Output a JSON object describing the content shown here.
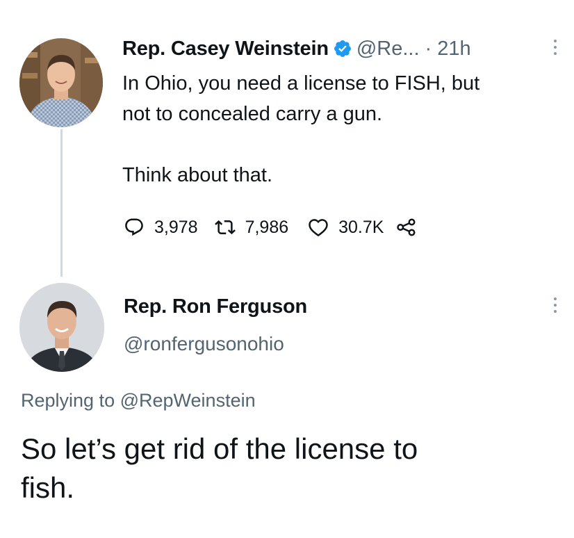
{
  "tweet": {
    "author_name": "Rep. Casey Weinstein",
    "handle": "@Re...",
    "separator": "·",
    "time": "21h",
    "text_line1": "In Ohio, you need a license to FISH, but",
    "text_line2": "not to concealed carry a gun.",
    "text_line3": "Think about that.",
    "stats": {
      "replies": "3,978",
      "retweets": "7,986",
      "likes": "30.7K"
    }
  },
  "reply": {
    "author_name": "Rep. Ron Ferguson",
    "handle": "@ronfergusonohio",
    "replying_prefix": "Replying to",
    "replying_to": "@RepWeinstein",
    "text_line1": "So let’s get rid of the license to",
    "text_line2": "fish."
  },
  "colors": {
    "verified_blue": "#1d9bf0",
    "muted": "#536471",
    "thread_line": "#cfd9de"
  },
  "icons": [
    "verified-badge-icon",
    "more-icon",
    "reply-icon",
    "retweet-icon",
    "like-icon",
    "share-icon"
  ]
}
